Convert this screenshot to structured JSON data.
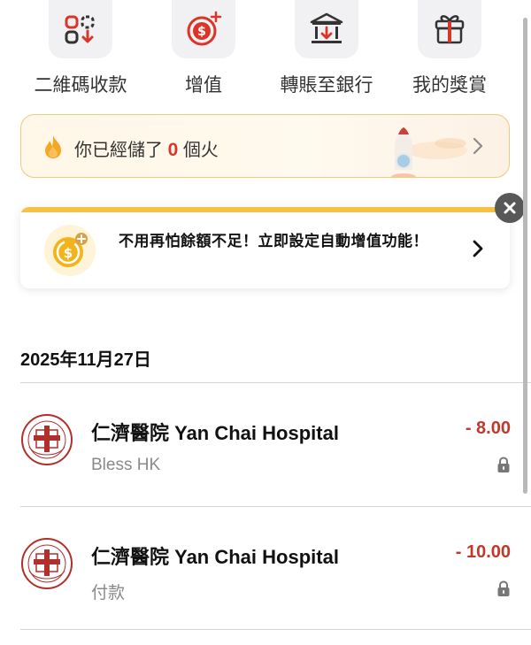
{
  "quick_actions": [
    {
      "label": "二維碼收款",
      "icon": "qr-receive-icon"
    },
    {
      "label": "增值",
      "icon": "top-up-dollar-icon"
    },
    {
      "label": "轉賬至銀行",
      "icon": "bank-transfer-icon"
    },
    {
      "label": "我的獎賞",
      "icon": "gift-icon"
    }
  ],
  "fire_banner": {
    "prefix": "你已經儲了",
    "count": "0",
    "suffix": "個火"
  },
  "promo": {
    "text": "不用再怕餘額不足！立即設定自動增值功能！"
  },
  "date_header": "2025年11月27日",
  "transactions": [
    {
      "name": "仁濟醫院 Yan Chai Hospital",
      "subtitle": "Bless HK",
      "amount": "- 8.00"
    },
    {
      "name": "仁濟醫院 Yan Chai Hospital",
      "subtitle": "付款",
      "amount": "- 10.00"
    }
  ],
  "colors": {
    "accent_red": "#d9362b",
    "amount_red": "#c0392b",
    "banner_border": "#f2c977",
    "promo_bar": "#f5c243"
  }
}
